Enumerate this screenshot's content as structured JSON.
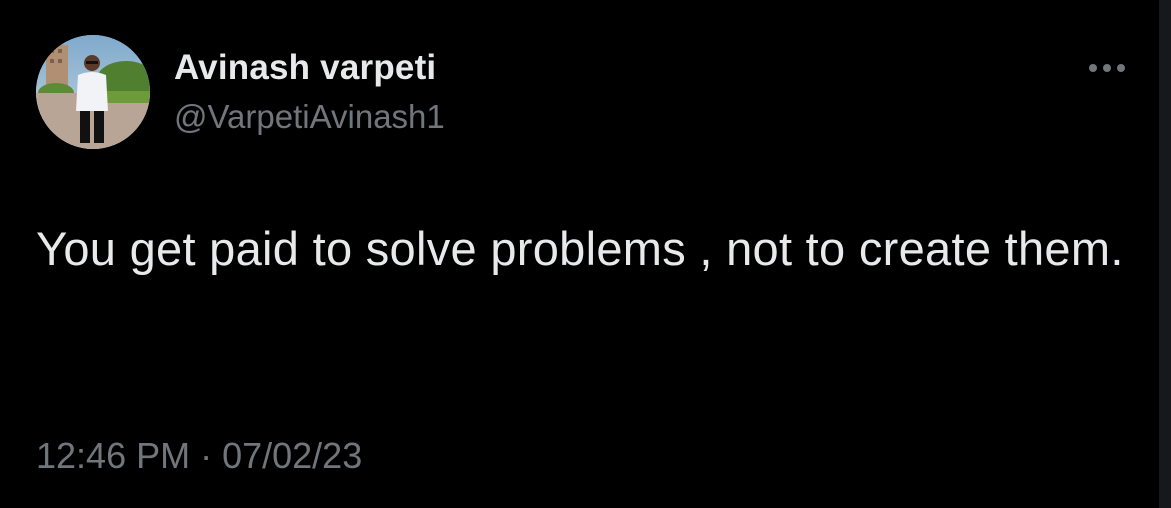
{
  "author": {
    "name": "Avinash varpeti",
    "handle": "@VarpetiAvinash1",
    "avatar_icon": "profile-photo"
  },
  "more_icon": "more-horizontal-icon",
  "tweet": {
    "text": "You get paid to solve problems , not to create them."
  },
  "meta": {
    "time": "12:46 PM",
    "separator": "·",
    "date": "07/02/23"
  },
  "colors": {
    "background": "#000000",
    "primary_text": "#e7e9ea",
    "secondary_text": "#71767b"
  }
}
